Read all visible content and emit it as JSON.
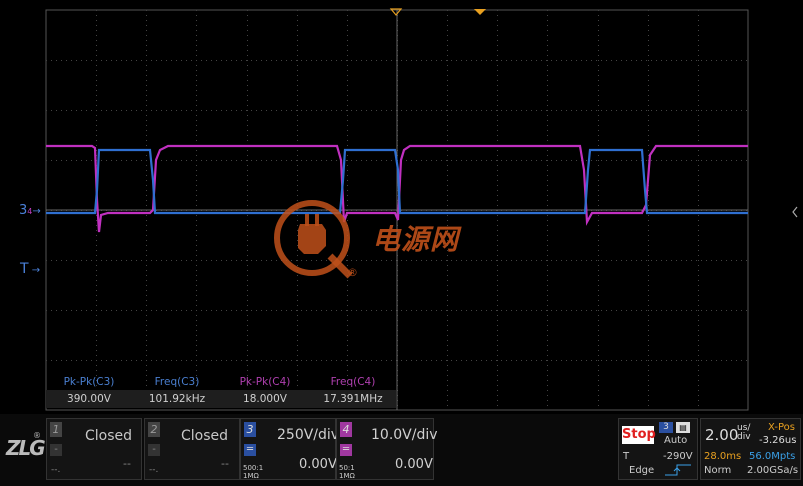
{
  "colors": {
    "ch3": "#2f6fd0",
    "ch4": "#c030c0",
    "grid": "#444444",
    "stop": "#e02020",
    "accent": "#e8a020",
    "watermark": "#c0501a"
  },
  "markers": {
    "ch_marker": "3",
    "ch_marker_sub": "4",
    "trigger_marker": "T"
  },
  "watermark": {
    "text": "电源网",
    "registered": "®"
  },
  "measurements": [
    {
      "name": "Pk-Pk(C3)",
      "value": "390.00V",
      "channel": "ch3"
    },
    {
      "name": "Freq(C3)",
      "value": "101.92kHz",
      "channel": "ch3"
    },
    {
      "name": "Pk-Pk(C4)",
      "value": "18.000V",
      "channel": "ch4"
    },
    {
      "name": "Freq(C4)",
      "value": "17.391MHz",
      "channel": "ch4"
    }
  ],
  "channels": [
    {
      "num": "1",
      "state": "Closed",
      "dash": "-",
      "left_small": "--.",
      "right_small": "--"
    },
    {
      "num": "2",
      "state": "Closed",
      "dash": "-",
      "left_small": "--.",
      "right_small": "--"
    },
    {
      "num": "3",
      "scale": "250V/div",
      "offset": "0.00V",
      "probe": "500:1",
      "imp": "1MΩ"
    },
    {
      "num": "4",
      "scale": "10.0V/div",
      "offset": "0.00V",
      "probe": "50:1",
      "imp": "1MΩ"
    }
  ],
  "status": {
    "state": "Stop",
    "trig_source": "3",
    "mode": "Auto",
    "trig_label": "T",
    "trig_level": "-290V",
    "trig_type": "Edge"
  },
  "timebase": {
    "scale": "2.00",
    "unit_top": "us/",
    "unit_bottom": "div",
    "xpos_label": "X-Pos",
    "xpos_value": "-3.26us",
    "record_time": "28.0ms",
    "memory": "56.0Mpts",
    "acq_mode": "Norm",
    "sample_rate": "2.00GSa/s"
  },
  "logo": "ZLG"
}
